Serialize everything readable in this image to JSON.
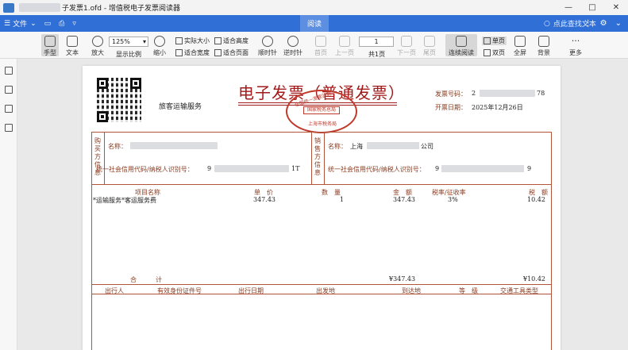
{
  "window": {
    "title": "子发票1.ofd - 增值税电子发票阅读器",
    "controls": [
      "—",
      "□",
      "✕"
    ]
  },
  "menu": {
    "file": "文件",
    "center_tab": "阅读",
    "search_placeholder": "点此查找文本"
  },
  "toolbar": {
    "hand": "手型",
    "text": "文本",
    "zoom_in": "放大",
    "zoom_value": "125%",
    "zoom_label": "显示比例",
    "zoom_out": "缩小",
    "actual_size": "实际大小",
    "fit_height": "适合高度",
    "fit_width": "适合宽度",
    "fit_page": "适合页面",
    "rotate_cw": "顺时针",
    "rotate_ccw": "逆时针",
    "first_page": "首页",
    "prev_page": "上一页",
    "page_value": "1",
    "total_pages": "共1页",
    "next_page": "下一页",
    "last_page": "尾页",
    "continuous": "连续阅读",
    "single_page": "单页",
    "double_page": "双页",
    "fullscreen": "全屏",
    "background": "背景",
    "more": "更多"
  },
  "invoice": {
    "title": "电子发票（普通发票）",
    "service_type": "旅客运输服务",
    "invoice_no_label": "发票号码：",
    "invoice_no_prefix": "2",
    "invoice_no_suffix": "78",
    "issue_date_label": "开票日期：",
    "issue_date": "2025年12月26日",
    "seal_top": "全国统一发票监制",
    "seal_middle": "国家税务总局",
    "seal_bottom": "上海市税务局",
    "buyer_label": "购买方信息",
    "seller_label": "销售方信息",
    "name_label": "名称：",
    "seller_name_prefix": "上海",
    "seller_name_suffix": "公司",
    "taxid_label": "统一社会信用代码/纳税人识别号：",
    "buyer_taxid_prefix": "9",
    "buyer_taxid_suffix": "1T",
    "seller_taxid_prefix": "9",
    "seller_taxid_suffix": "9",
    "columns": {
      "item": "项目名称",
      "unit_price": "单　价",
      "quantity": "数　量",
      "amount": "金　额",
      "tax_rate": "税率/征收率",
      "tax": "税　额"
    },
    "line_item": {
      "item": "*运输服务*客运服务费",
      "unit_price": "347.43",
      "quantity": "1",
      "amount": "347.43",
      "tax_rate": "3%",
      "tax": "10.42"
    },
    "total_label": "合　　　计",
    "total_amount": "¥347.43",
    "total_tax": "¥10.42",
    "travel_columns": {
      "traveler": "出行人",
      "id_no": "有效身份证件号",
      "date": "出行日期",
      "origin": "出发地",
      "destination": "到达地",
      "class": "等　级",
      "vehicle": "交通工具类型"
    }
  }
}
